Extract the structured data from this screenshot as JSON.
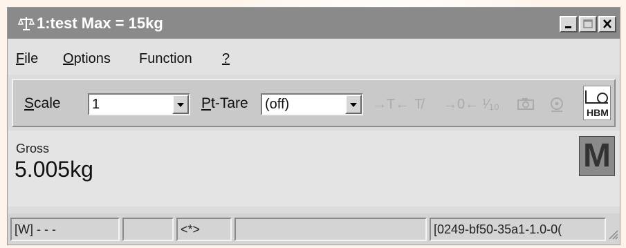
{
  "window": {
    "title": "1:test Max = 15kg",
    "icon": "scale-icon",
    "controls": [
      "minimize",
      "maximize",
      "close"
    ]
  },
  "menu": {
    "file": {
      "accel": "F",
      "rest": "ile"
    },
    "options": {
      "accel": "O",
      "rest": "ptions"
    },
    "function": {
      "label": "Function"
    },
    "help": {
      "accel": "?"
    }
  },
  "toolbar": {
    "scale_label": {
      "accel": "S",
      "rest": "cale"
    },
    "scale_value": "1",
    "pttare_label": {
      "accel": "P",
      "rest": "t-Tare"
    },
    "pttare_value": "(off)",
    "tools": [
      {
        "name": "tare-icon",
        "glyph": "→T←"
      },
      {
        "name": "clear-tare-icon",
        "glyph": "T̸"
      },
      {
        "name": "zero-icon",
        "glyph": "→0←"
      },
      {
        "name": "tenth-resolution-icon",
        "glyph": "¹⁄₁₀"
      },
      {
        "name": "camera-icon",
        "glyph": "📷"
      },
      {
        "name": "target-icon",
        "glyph": "⊙"
      }
    ],
    "logo": "HBM"
  },
  "display": {
    "mode_label": "Gross",
    "weight": "5.005kg",
    "indicator": "M"
  },
  "status": {
    "cell1": "[W] - - -",
    "cell2": "",
    "cell3": "<*>",
    "cell4": "",
    "cell5": "[0249-bf50-35a1-1.0-0("
  },
  "colors": {
    "titlebar": "#8a8a8a",
    "window": "#dcdcdc",
    "toolbar": "#c9c9c9",
    "indicator_bg": "#8a8a8a"
  }
}
